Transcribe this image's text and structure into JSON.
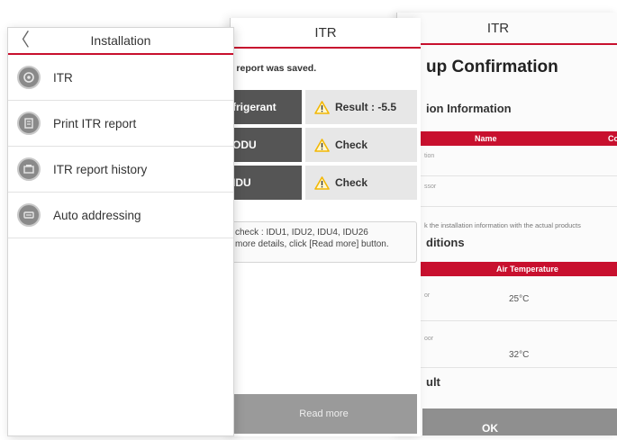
{
  "confirmation": {
    "header_title": "ITR",
    "title": "up Confirmation",
    "section_info": "ion Information",
    "info_table_headers": [
      "Name",
      "Co"
    ],
    "info_row_labels": [
      "tion",
      "ssor"
    ],
    "note": "k the installation information with the actual products",
    "section_conditions": "ditions",
    "cond_table_headers": [
      "Air Temperature"
    ],
    "cond_rows": [
      {
        "label": "or",
        "value": "25°C"
      },
      {
        "label": "oor",
        "value": "32°C"
      }
    ],
    "section_result": "ult",
    "ok_label": "OK"
  },
  "itr": {
    "header_title": "ITR",
    "saved_message": "t report was saved.",
    "rows": [
      {
        "key": "frigerant",
        "value": "Result : -5.5"
      },
      {
        "key": "ODU",
        "value": "Check"
      },
      {
        "key": "IDU",
        "value": "Check"
      }
    ],
    "check_line1": "check : IDU1, IDU2, IDU4, IDU26",
    "check_line2": "more details, click [Read more] button.",
    "read_more_label": "Read more",
    "warn_color": "#f2b705"
  },
  "installation": {
    "header_title": "Installation",
    "back_glyph": "〈",
    "items": [
      {
        "label": "ITR",
        "icon": "itr-icon"
      },
      {
        "label": "Print ITR report",
        "icon": "print-report-icon"
      },
      {
        "label": "ITR report history",
        "icon": "report-history-icon"
      },
      {
        "label": "Auto addressing",
        "icon": "auto-addressing-icon"
      }
    ],
    "accent_color": "#c8102e"
  }
}
